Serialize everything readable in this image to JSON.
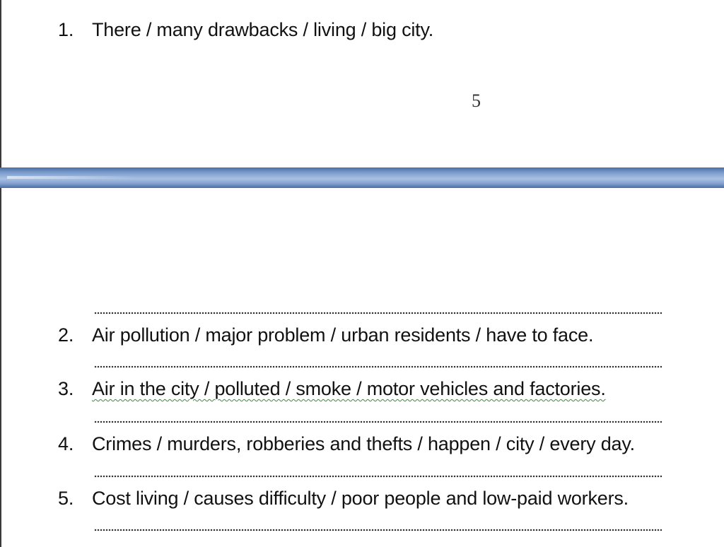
{
  "exercise": {
    "items": [
      {
        "number": "1.",
        "text": "There / many drawbacks / living / big city."
      },
      {
        "number": "2.",
        "text": "Air pollution / major problem / urban residents / have to face."
      },
      {
        "number": "3.",
        "text": "Air in the city / polluted / smoke / motor vehicles and factories."
      },
      {
        "number": "4.",
        "text": "Crimes / murders, robberies and thefts / happen / city / every day."
      },
      {
        "number": "5.",
        "text": "Cost living / causes difficulty / poor people and low-paid workers."
      }
    ]
  },
  "page": {
    "page_number": "5"
  },
  "colors": {
    "page_break_band": "#7b9ccc",
    "spellcheck_underline": "#3b8a3b"
  }
}
